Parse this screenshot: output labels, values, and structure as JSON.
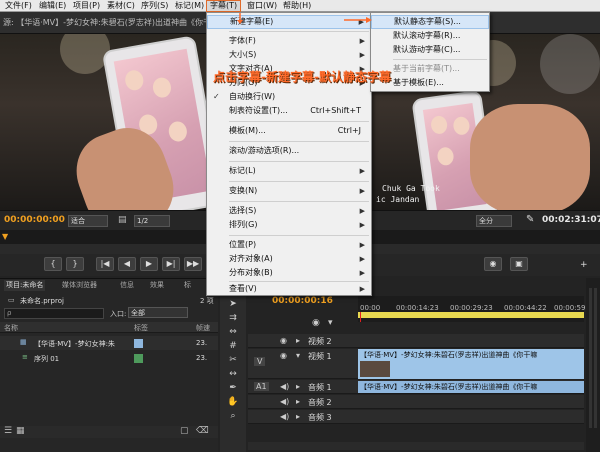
{
  "menubar": {
    "items": [
      "文件(F)",
      "编辑(E)",
      "项目(P)",
      "素材(C)",
      "序列(S)",
      "标记(M)",
      "字幕(T)",
      "窗口(W)",
      "帮助(H)"
    ]
  },
  "source": {
    "tab_label": "源: 【华语·MV】-梦幻女神:朱碧石(罗志祥)出道神曲《你干嘛》",
    "subtitle_line1": "Chuk Ga Took",
    "subtitle_line2": "ic Jandan",
    "timecode_in": "00:00:00:00",
    "fit_label": "适合",
    "zoom_label": "1/2",
    "view_label": "全分",
    "timecode_out": "00:02:31:07"
  },
  "project": {
    "tabs": [
      "项目:未命名",
      "媒体浏览器",
      "信息",
      "效果",
      "标"
    ],
    "count": "2 项",
    "filename": "未命名.prproj",
    "search_placeholder": "ρ",
    "in_label": "入口:",
    "in_value": "全部",
    "columns": {
      "name": "名称",
      "label": "标签",
      "rate": "帧速"
    },
    "items": [
      {
        "name": "【华语·MV】-梦幻女神:朱",
        "rate": "23."
      },
      {
        "name": "序列 01",
        "rate": "23."
      }
    ]
  },
  "timeline": {
    "timecode": "00:00:00:16",
    "ruler": [
      "00:00",
      "00:00:14:23",
      "00:00:29:23",
      "00:00:44:22",
      "00:00:59:2"
    ],
    "tracks": [
      {
        "label": "视频 2"
      },
      {
        "label": "视频 1"
      },
      {
        "label": "音频 1"
      },
      {
        "label": "音频 2"
      },
      {
        "label": "音频 3"
      }
    ],
    "side_v": "V",
    "side_a": "A1",
    "video_clip": "【华语·MV】-梦幻女神:朱碧石(罗志祥)出道神曲《你干嘛",
    "audio_clip": "【华语·MV】-梦幻女神:朱碧石(罗志祥)出道神曲《你干嘛"
  },
  "title_menu": {
    "items": [
      {
        "label": "新建字幕(E)",
        "arrow": true,
        "highlight": true
      },
      {
        "label": "字体(F)",
        "arrow": true
      },
      {
        "label": "大小(S)",
        "arrow": true
      },
      {
        "label": "文字对齐(A)",
        "arrow": true
      },
      {
        "label": "方向(O)",
        "arrow": true
      },
      {
        "label": "自动换行(W)",
        "checked": true
      },
      {
        "label": "制表符设置(T)...",
        "shortcut": "Ctrl+Shift+T"
      },
      {
        "label": "模板(M)...",
        "shortcut": "Ctrl+J"
      },
      {
        "label": "滚动/游动选项(R)..."
      },
      {
        "label": "标记(L)",
        "arrow": true
      },
      {
        "label": "变换(N)",
        "arrow": true
      },
      {
        "label": "选择(S)",
        "arrow": true
      },
      {
        "label": "排列(G)",
        "arrow": true
      },
      {
        "label": "位置(P)",
        "arrow": true
      },
      {
        "label": "对齐对象(A)",
        "arrow": true
      },
      {
        "label": "分布对象(B)",
        "arrow": true
      },
      {
        "label": "查看(V)",
        "arrow": true
      }
    ]
  },
  "new_title_submenu": {
    "items": [
      {
        "label": "默认静态字幕(S)...",
        "highlight": true
      },
      {
        "label": "默认滚动字幕(R)..."
      },
      {
        "label": "默认游动字幕(C)..."
      },
      {
        "label": "基于当前字幕(T)...",
        "disabled": true
      },
      {
        "label": "基于模板(E)..."
      }
    ]
  },
  "annotation": "点击字幕-新建字幕-默认静态字幕",
  "colors": {
    "accent": "#e06a2a",
    "timecode": "#f0a020",
    "video_clip": "#9ec5e8",
    "audio_clip": "#8fb7de",
    "annotation": "#ff6a2a"
  }
}
